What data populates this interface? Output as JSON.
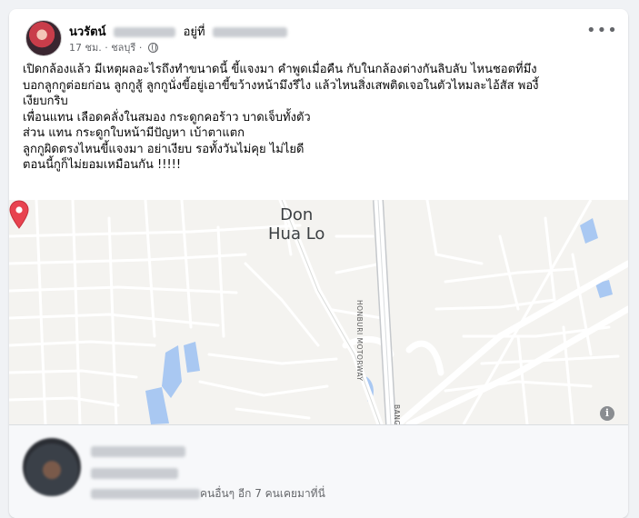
{
  "post": {
    "author_name": "นวรัตน์",
    "at_label": "อยู่ที่",
    "time": "17 ชม.",
    "separator": "·",
    "location": "ชลบุรี",
    "privacy_icon": "globe-icon",
    "more_label": "•••",
    "text_lines": [
      "เปิดกล้องแล้ว มีเหตุผลอะไรถึงทำขนาดนี้ ขี้แจงมา คำพูดเมื่อคืน กับในกล้องต่างกันลิบลับ  ไหนชอตที่มึง",
      "บอกลูกกูต่อยก่อน ลูกกูสู้ ลูกกูนั่งขี้อยู่เอาขี้ขว้างหน้ามึงรึไง แล้วไหนสิ่งเสพติดเจอในตัวไหมละไอ้สัส พองี้",
      "เงียบกริบ",
      "เพื่อนแทน เลือดคลั่งในสมอง กระดูกคอร้าว บาดเจ็บทั้งตัว",
      "ส่วน แทน กระดูกใบหน้ามีปัญหา  เบ้าตาแตก",
      "ลูกกูผิดตรงไหนขี้แจงมา อย่าเงียบ รอทั้งวันไม่คุย ไม่ไยดี",
      "ตอนนี้กูก็ไม่ยอมเหมือนกัน !!!!!"
    ]
  },
  "map": {
    "place_line1": "Don",
    "place_line2": "Hua Lo",
    "road_label": "HONBURI MOTORWAY",
    "road_label2": "BANG",
    "info_label": "i",
    "pin_color": "#e8434f"
  },
  "footer": {
    "visitors_text": "คนอื่นๆ อีก 7 คนเคยมาที่นี่"
  }
}
